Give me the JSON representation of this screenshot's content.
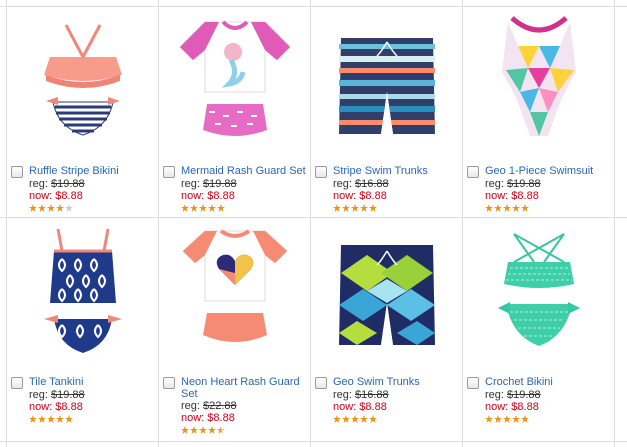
{
  "labels": {
    "reg": "reg: ",
    "now": "now: "
  },
  "colors": {
    "link": "#2a66b4",
    "sale": "#d0021b",
    "star": "#e8961c",
    "star_empty": "#cccccc"
  },
  "products": [
    {
      "name": "Ruffle Stripe Bikini",
      "reg": "$19.88",
      "now": "$8.88",
      "rating": 4
    },
    {
      "name": "Mermaid Rash Guard Set",
      "reg": "$19.88",
      "now": "$8.88",
      "rating": 5
    },
    {
      "name": "Stripe Swim Trunks",
      "reg": "$16.88",
      "now": "$8.88",
      "rating": 5
    },
    {
      "name": "Geo 1-Piece Swimsuit",
      "reg": "$19.88",
      "now": "$8.88",
      "rating": 5
    },
    {
      "name": "Tile Tankini",
      "reg": "$19.88",
      "now": "$8.88",
      "rating": 5
    },
    {
      "name": "Neon Heart Rash Guard Set",
      "reg": "$22.88",
      "now": "$8.88",
      "rating": 4.5
    },
    {
      "name": "Geo Swim Trunks",
      "reg": "$16.88",
      "now": "$8.88",
      "rating": 5
    },
    {
      "name": "Crochet Bikini",
      "reg": "$19.88",
      "now": "$8.88",
      "rating": 5
    }
  ]
}
